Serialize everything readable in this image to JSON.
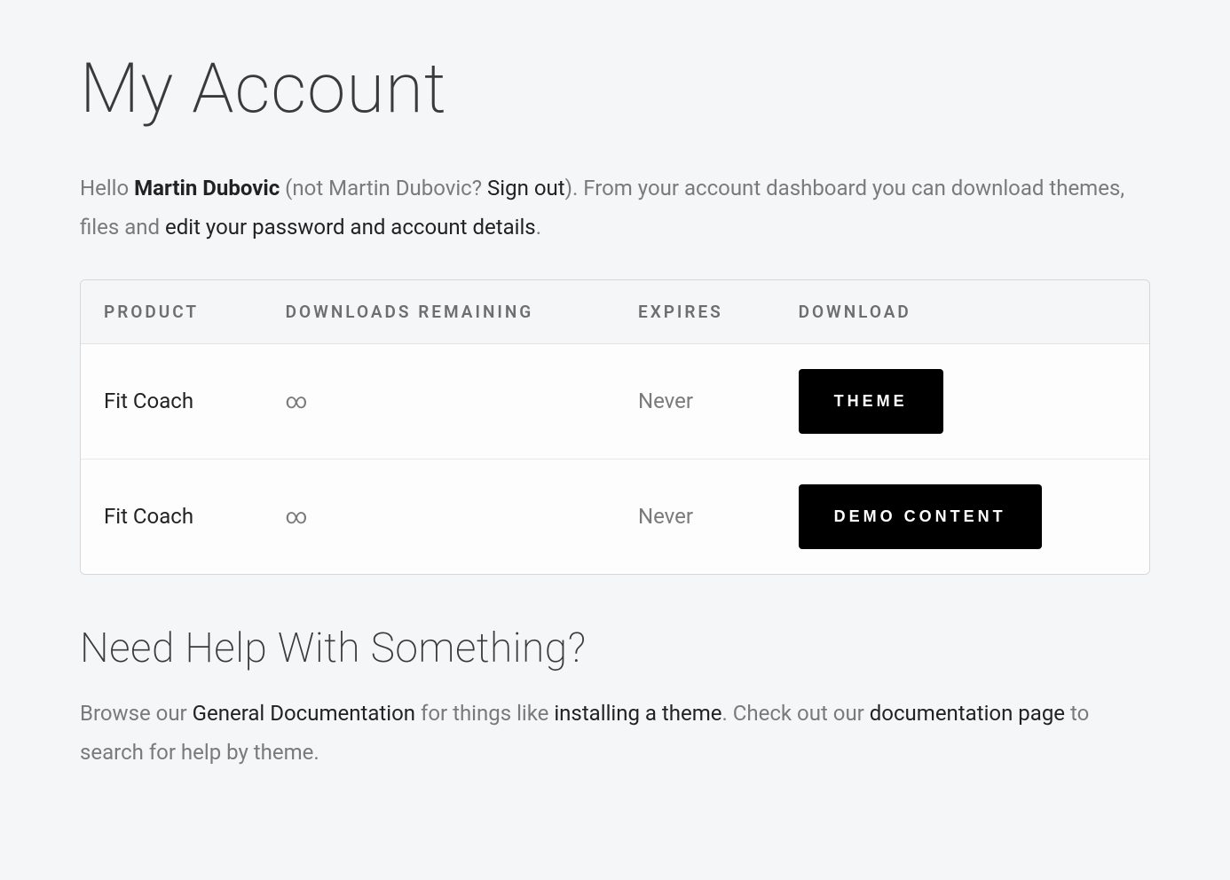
{
  "page_title": "My Account",
  "intro": {
    "hello": "Hello ",
    "user_name": "Martin Dubovic",
    "not_user_prefix": " (not Martin Dubovic? ",
    "sign_out_label": "Sign out",
    "after_sign_out": "). From your account dashboard you can download themes, files and ",
    "edit_link_label": "edit your password and account details",
    "period": "."
  },
  "table": {
    "headers": {
      "product": "Product",
      "remaining": "Downloads Remaining",
      "expires": "Expires",
      "download": "Download"
    },
    "rows": [
      {
        "product": "Fit Coach",
        "remaining": "∞",
        "expires": "Never",
        "button": "Theme"
      },
      {
        "product": "Fit Coach",
        "remaining": "∞",
        "expires": "Never",
        "button": "Demo Content"
      }
    ]
  },
  "help": {
    "title": "Need Help With Something?",
    "p1_prefix": "Browse our ",
    "general_docs_label": "General Documentation",
    "p1_mid": " for things like ",
    "installing_label": "installing a theme",
    "p1_after_install": ". Check out our ",
    "doc_page_label": "documentation page",
    "p1_suffix": " to search for help by theme."
  }
}
